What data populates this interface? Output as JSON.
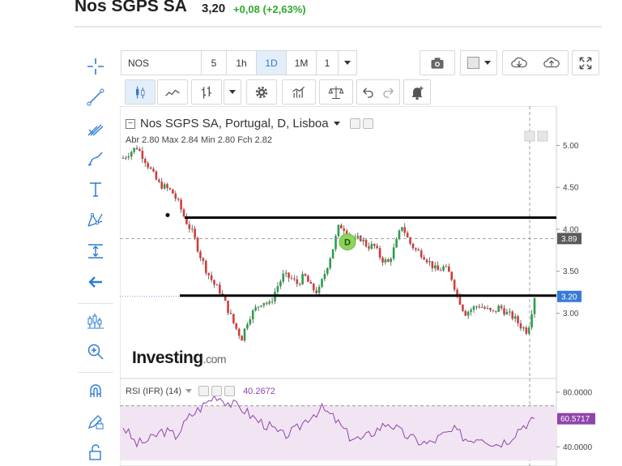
{
  "header": {
    "title": "Nos SGPS SA",
    "price": "3,20",
    "change": "+0,08 (+2,63%)"
  },
  "toolbar": {
    "symbol": "NOS",
    "intervals": [
      "5",
      "1h",
      "1D",
      "1M"
    ],
    "active_interval": "1D",
    "count": "1"
  },
  "legend": {
    "title": "Nos SGPS SA, Portugal, D, Lisboa",
    "ohlc": "Abr 2.80  Max 2.84  Min 2.80  Fch 2.82"
  },
  "rsi": {
    "label": "RSI (IFR) (14)",
    "value": "40.2672",
    "last": "60.5717"
  },
  "logo": {
    "main": "Investing",
    "suffix": ".com"
  },
  "colors": {
    "up": "#2a9d4a",
    "down": "#d43b3b",
    "rsi": "#8e44ad",
    "rsi_band": "#f2e5f3",
    "marker": "#8ed35a",
    "change": "#2eaa2e"
  },
  "chart_data": {
    "type": "candlestick",
    "price_axis": {
      "ticks": [
        5.0,
        4.5,
        4.0,
        3.5,
        3.0
      ],
      "range": [
        2.57,
        5.12
      ]
    },
    "price_badges": {
      "crosshair": 3.89,
      "last": 3.2
    },
    "price_path": [
      4.85,
      4.92,
      4.98,
      4.85,
      4.7,
      4.55,
      4.5,
      4.45,
      4.3,
      4.1,
      3.95,
      3.7,
      3.5,
      3.35,
      3.25,
      3.05,
      2.85,
      2.7,
      2.95,
      3.05,
      3.15,
      3.1,
      3.3,
      3.45,
      3.42,
      3.35,
      3.45,
      3.3,
      3.25,
      3.5,
      3.75,
      4.05,
      4.0,
      3.85,
      3.9,
      3.8,
      3.8,
      3.65,
      3.6,
      3.8,
      4.05,
      3.85,
      3.75,
      3.7,
      3.6,
      3.5,
      3.55,
      3.45,
      3.2,
      3.0,
      3.05,
      3.1,
      3.05,
      3.0,
      3.08,
      3.0,
      2.95,
      2.85,
      2.78,
      3.2
    ],
    "lines": [
      {
        "label": "resistance",
        "y": 4.14
      },
      {
        "label": "support",
        "y": 3.21
      }
    ],
    "marker": {
      "label": "D",
      "y": 3.85
    },
    "rsi_axis": {
      "ticks": [
        80.0,
        40.0
      ]
    },
    "rsi_path": [
      55,
      42,
      45,
      52,
      48,
      62,
      70,
      78,
      72,
      68,
      60,
      55,
      48,
      52,
      62,
      68,
      60,
      48,
      45,
      52,
      58,
      50,
      45,
      42,
      48,
      52,
      45,
      48,
      42,
      45,
      55,
      60.57
    ]
  }
}
